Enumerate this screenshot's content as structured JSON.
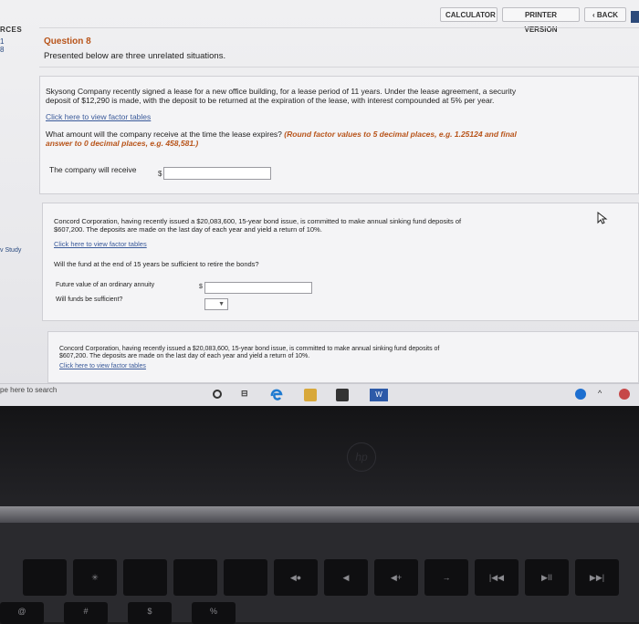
{
  "topbar": {
    "calculator_label": "CALCULATOR",
    "printer_version_label": "PRINTER VERSION",
    "back_label": "‹ BACK"
  },
  "sidebar": {
    "resources_label": "RCES",
    "item_a": "1",
    "item_b": "8",
    "study_label": "v Study"
  },
  "question": {
    "title": "Question 8",
    "intro": "Presented below are three unrelated situations."
  },
  "part1": {
    "text_line1": "Skysong Company recently signed a lease for a new office building, for a lease period of 11 years. Under the lease agreement, a security",
    "text_line2": "deposit of $12,290 is made, with the deposit to be returned at the expiration of the lease, with interest compounded at 5% per year.",
    "link": "Click here to view factor tables",
    "prompt": "What amount will the company receive at the time the lease expires?",
    "instruction_line1": "(Round factor values to 5 decimal places, e.g. 1.25124 and final",
    "instruction_line2": "answer to 0 decimal places, e.g. 458,581.)",
    "answer_label": "The company will receive",
    "currency": "$",
    "answer_value": ""
  },
  "part2": {
    "text_line1": "Concord Corporation, having recently issued a $20,083,600, 15-year bond issue, is committed to make annual sinking fund deposits of",
    "text_line2": "$607,200. The deposits are made on the last day of each year and yield a return of 10%.",
    "link": "Click here to view factor tables",
    "prompt": "Will the fund at the end of 15 years be sufficient to retire the bonds?",
    "fv_label": "Future value of an ordinary annuity",
    "currency": "$",
    "fv_value": "",
    "sufficient_label": "Will funds be sufficient?",
    "sufficient_value": ""
  },
  "part3": {
    "text_line1": "Concord Corporation, having recently issued a $20,083,600, 15-year bond issue, is committed to make annual sinking fund deposits of",
    "text_line2": "$607,200. The deposits are made on the last day of each year and yield a return of 10%.",
    "link": "Click here to view factor tables"
  },
  "taskbar": {
    "search_text": "pe here to search",
    "word_label": "W"
  },
  "device": {
    "logo_text": "hp"
  },
  "keyboard": {
    "keys_row1": [
      "",
      "✳",
      "",
      "",
      "",
      "",
      "◀●",
      "◀",
      "◀+",
      "→",
      "|◀◀",
      "▶II",
      "▶▶|"
    ],
    "keys_row2": [
      "@",
      "#",
      "$",
      "%"
    ]
  },
  "colors": {
    "accent_orange": "#b8541a",
    "link_blue": "#3a5a9a"
  }
}
